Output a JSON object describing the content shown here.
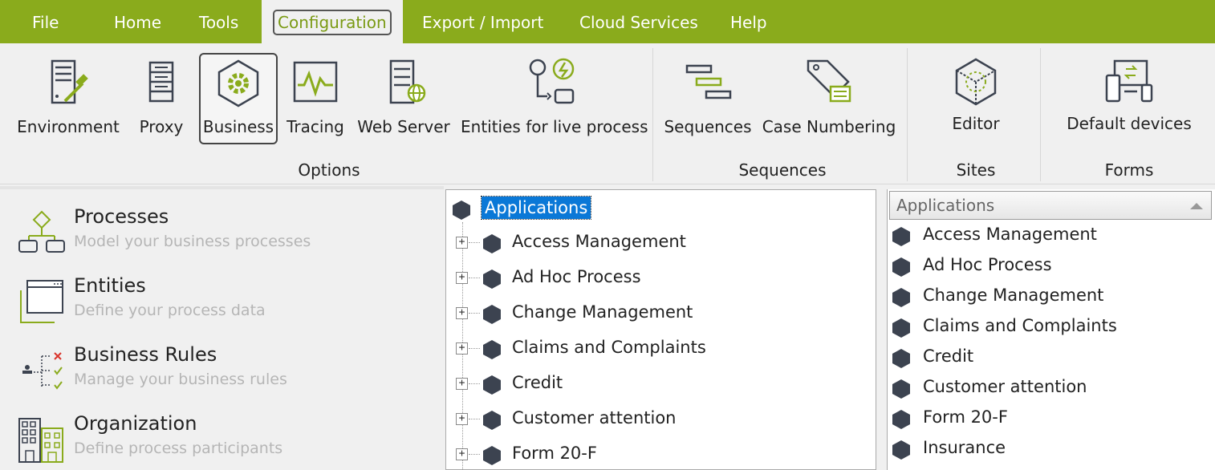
{
  "menu": {
    "items": [
      "File",
      "Home",
      "Tools",
      "Configuration",
      "Export / Import",
      "Cloud Services",
      "Help"
    ],
    "active": "Configuration"
  },
  "ribbon": {
    "options": [
      "Environment",
      "Proxy",
      "Business",
      "Tracing",
      "Web Server",
      "Entities for live process"
    ],
    "options_group": "Options",
    "sequences": [
      "Sequences",
      "Case Numbering"
    ],
    "sequences_group": "Sequences",
    "sites": [
      "Editor"
    ],
    "sites_group": "Sites",
    "forms": [
      "Default devices"
    ],
    "forms_group": "Forms",
    "selected": "Business"
  },
  "nav": [
    {
      "title": "Processes",
      "subtitle": "Model your business processes",
      "icon": "processes-icon"
    },
    {
      "title": "Entities",
      "subtitle": "Define your process data",
      "icon": "entities-icon"
    },
    {
      "title": "Business Rules",
      "subtitle": "Manage your business rules",
      "icon": "business-rules-icon"
    },
    {
      "title": "Organization",
      "subtitle": "Define process participants",
      "icon": "organization-icon"
    }
  ],
  "tree": {
    "root": "Applications",
    "children": [
      "Access Management",
      "Ad Hoc Process",
      "Change Management",
      "Claims and Complaints",
      "Credit",
      "Customer attention",
      "Form 20-F"
    ],
    "expand_symbol": "+"
  },
  "list": {
    "header": "Applications",
    "items": [
      "Access Management",
      "Ad Hoc Process",
      "Change Management",
      "Claims and Complaints",
      "Credit",
      "Customer attention",
      "Form 20-F",
      "Insurance"
    ]
  },
  "colors": {
    "brand": "#8aab1c",
    "selection": "#0a78d7",
    "icon_dark": "#3c4350",
    "icon_green": "#8aab1c"
  }
}
